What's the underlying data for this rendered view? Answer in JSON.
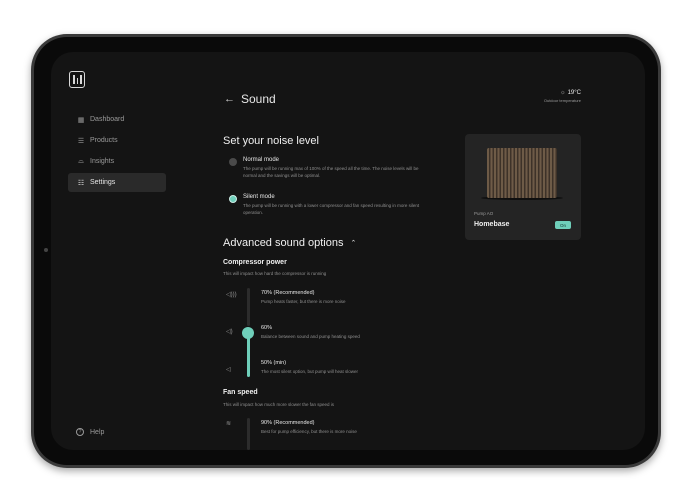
{
  "app": {
    "logo_icon": "homebase-logo",
    "accent_color": "#6fcfba"
  },
  "sidebar": {
    "items": [
      {
        "label": "Dashboard",
        "icon": "grid-icon",
        "active": false
      },
      {
        "label": "Products",
        "icon": "list-icon",
        "active": false
      },
      {
        "label": "Insights",
        "icon": "chart-icon",
        "active": false
      },
      {
        "label": "Settings",
        "icon": "sliders-icon",
        "active": true
      }
    ],
    "help_label": "Help"
  },
  "header": {
    "back_label": "Sound",
    "temperature": "19°C",
    "temperature_label": "Outdoor temperature"
  },
  "noise": {
    "heading": "Set your noise level",
    "options": [
      {
        "title": "Normal mode",
        "description": "The pump will be running max of 100% of the speed all the time. The noise levels will be normal and the savings will be optimal.",
        "selected": false
      },
      {
        "title": "Silent mode",
        "description": "The pump will be running with a lower compressor and fan speed resulting in more silent operation.",
        "selected": true
      }
    ]
  },
  "advanced": {
    "heading": "Advanced sound options",
    "compressor": {
      "title": "Compressor power",
      "description": "This will impact how hard the compressor is running",
      "selected_level": "60%",
      "options": [
        {
          "title": "70% (Recommended)",
          "description": "Pump heats faster, but there is more noise"
        },
        {
          "title": "60%",
          "description": "Balance between sound and pump heating speed"
        },
        {
          "title": "50% (min)",
          "description": "The most silent option, but pump will heat slower"
        }
      ]
    },
    "fan": {
      "title": "Fan speed",
      "description": "This will impact how much more slower the fan speed is",
      "options": [
        {
          "title": "90% (Recommended)",
          "description": "Best for pump efficiency, but there is more noise"
        }
      ]
    }
  },
  "device": {
    "label": "Pump AO",
    "name": "Homebase",
    "status": "On"
  }
}
